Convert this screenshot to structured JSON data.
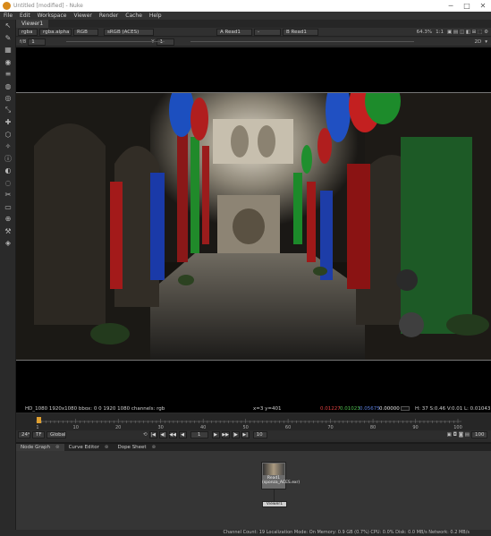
{
  "window": {
    "title": "Untitled [modified] - Nuke",
    "controls": [
      "─",
      "□",
      "✕"
    ]
  },
  "menubar": [
    "File",
    "Edit",
    "Workspace",
    "Viewer",
    "Render",
    "Cache",
    "Help"
  ],
  "left_toolbar": [
    "↖",
    "✎",
    "▦",
    "◉",
    "≡",
    "◍",
    "◎",
    "⤡",
    "✚",
    "⬡",
    "✧",
    "ⓘ",
    "◐",
    "◌",
    "✂",
    "▭",
    "⊕",
    "⚒",
    "◈"
  ],
  "viewer_tab": "Viewer1",
  "viewer_controls": {
    "layer": "rgba",
    "channel": "rgba.alpha",
    "display": "RGB",
    "colorspace": "sRGB (ACES)",
    "input_a": "A  Read1",
    "input_op": "-",
    "input_b": "B  Read1",
    "zoom": "64.3%",
    "ratio": "1:1",
    "fstop_label": "f/8",
    "fstop_value": "1",
    "y_label": "Y",
    "y_value": "1",
    "mode_2d": "2D"
  },
  "infobar": {
    "format": "HD_1080 1920x1080  bbox: 0 0 1920 1080  channels: rgb",
    "coords": "x=3 y=401",
    "r": "0.01227",
    "g": "0.01023",
    "b": "0.05675",
    "a": "0.00000",
    "hsvl": "H: 37 S:0.46 V:0.01  L: 0.01043"
  },
  "timeline": {
    "ticks": [
      "1",
      "10",
      "20",
      "30",
      "40",
      "50",
      "60",
      "70",
      "80",
      "90",
      "100"
    ],
    "start": "1",
    "end": "100",
    "current_frame": "1",
    "fps": "24*",
    "tf": "TF",
    "global": "Global",
    "step": "10"
  },
  "playbar_buttons": [
    "|◀",
    "◀|",
    "◀◀",
    "◀",
    "▶",
    "▶▶",
    "|▶",
    "▶|"
  ],
  "node_graph_tabs": [
    {
      "label": "Node Graph",
      "active": true
    },
    {
      "label": "Curve Editor",
      "active": false
    },
    {
      "label": "Dope Sheet",
      "active": false
    }
  ],
  "nodes": {
    "read_label": "Read1",
    "read_sub": "(sponza_ACES.exr)",
    "viewer_label": "Viewer1"
  },
  "statusbar": "Channel Count: 19  Localization Mode: On  Memory: 0.9 GB (0.7%)  CPU: 0.0%  Disk: 0.0 MB/s  Network: 0.2 MB/s"
}
